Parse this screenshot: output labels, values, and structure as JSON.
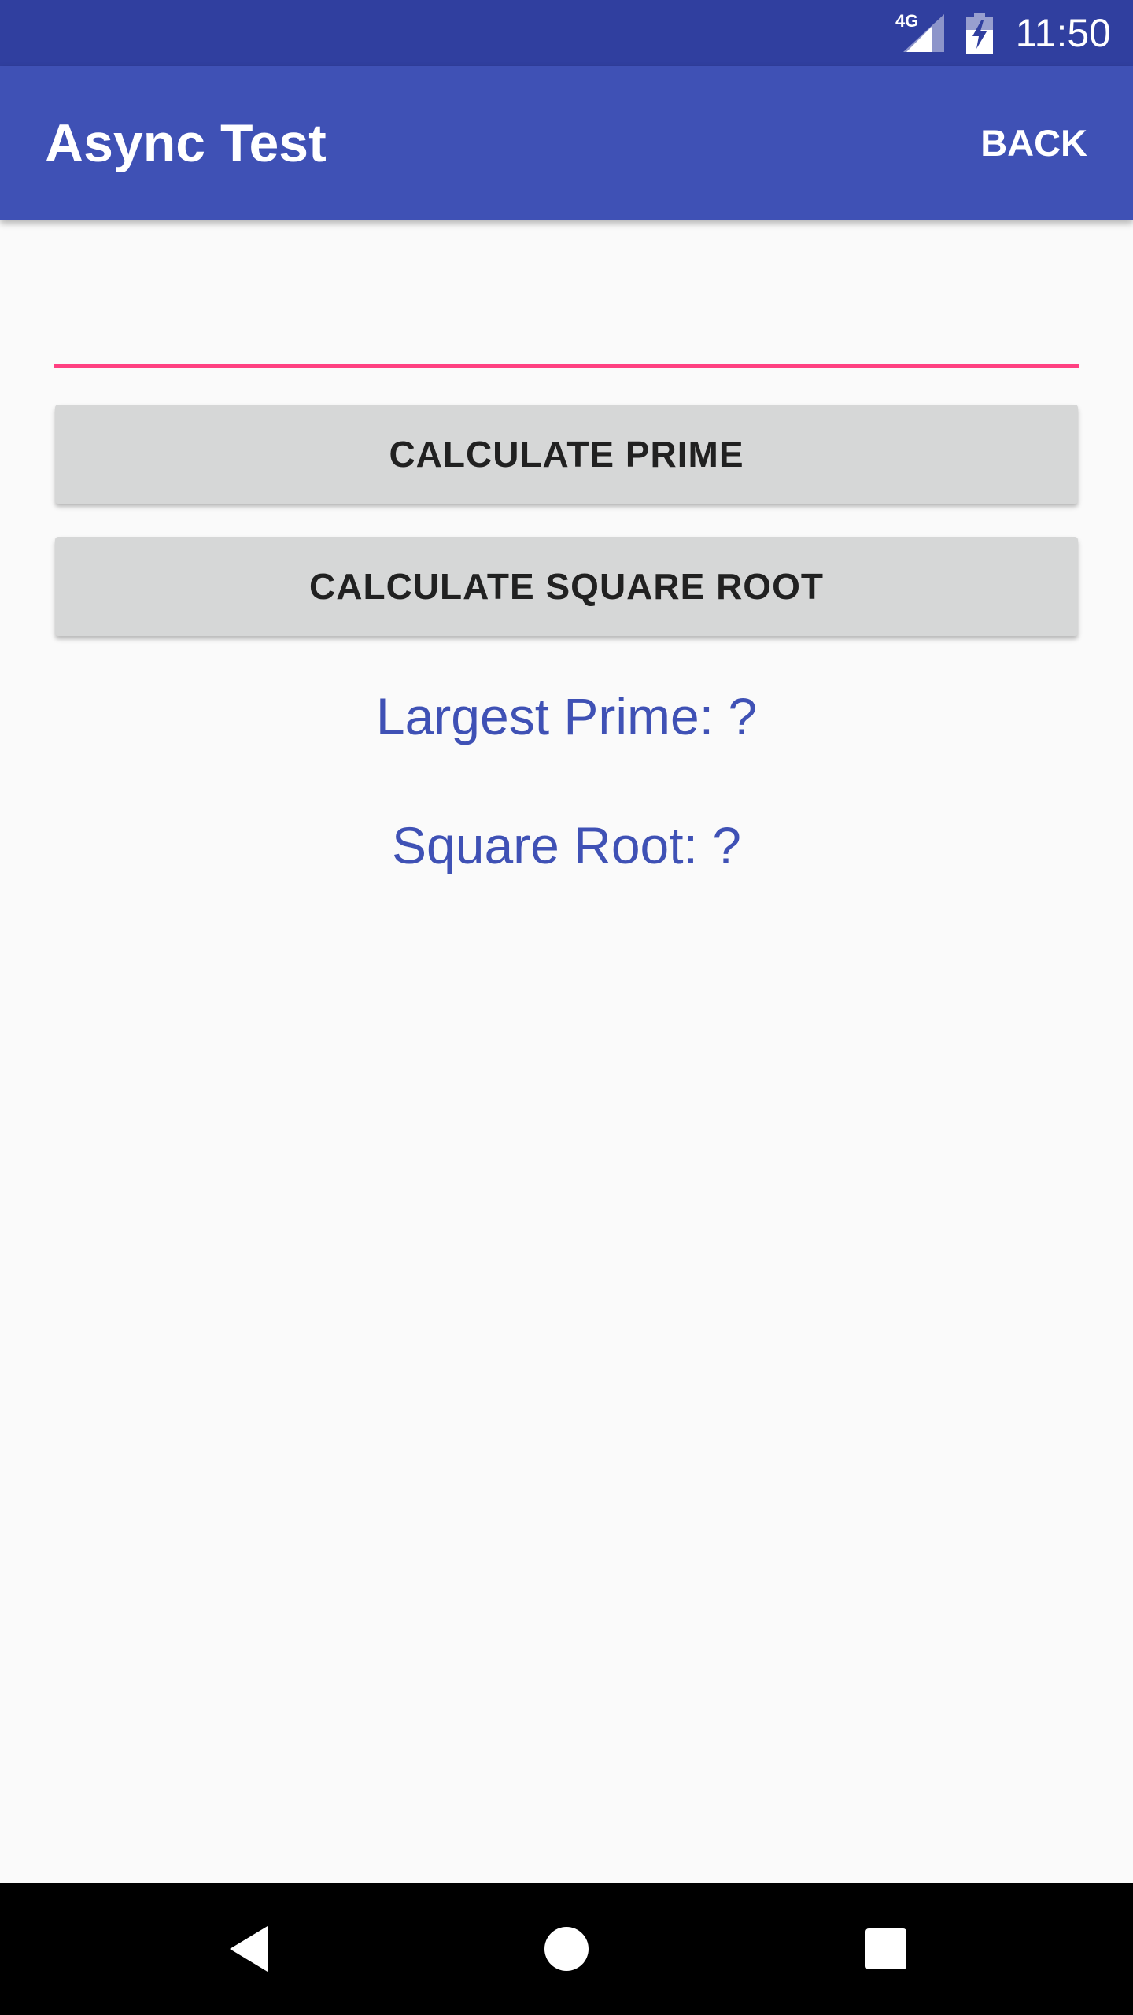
{
  "status_bar": {
    "time": "11:50",
    "network": "4G",
    "icons": [
      "signal-icon",
      "battery-charging-icon"
    ]
  },
  "app_bar": {
    "title": "Async Test",
    "action_label": "BACK"
  },
  "input": {
    "value": "",
    "accent_color": "#FF4081"
  },
  "buttons": {
    "prime_label": "CALCULATE PRIME",
    "sqrt_label": "CALCULATE SQUARE ROOT"
  },
  "results": {
    "prime_text": "Largest Prime: ?",
    "sqrt_text": "Square Root: ?"
  },
  "nav_bar": {
    "icons": [
      "back-icon",
      "home-icon",
      "recents-icon"
    ]
  },
  "colors": {
    "primary": "#3F51B5",
    "primary_dark": "#303F9F",
    "accent": "#FF4081",
    "button_bg": "#D6D7D7"
  }
}
